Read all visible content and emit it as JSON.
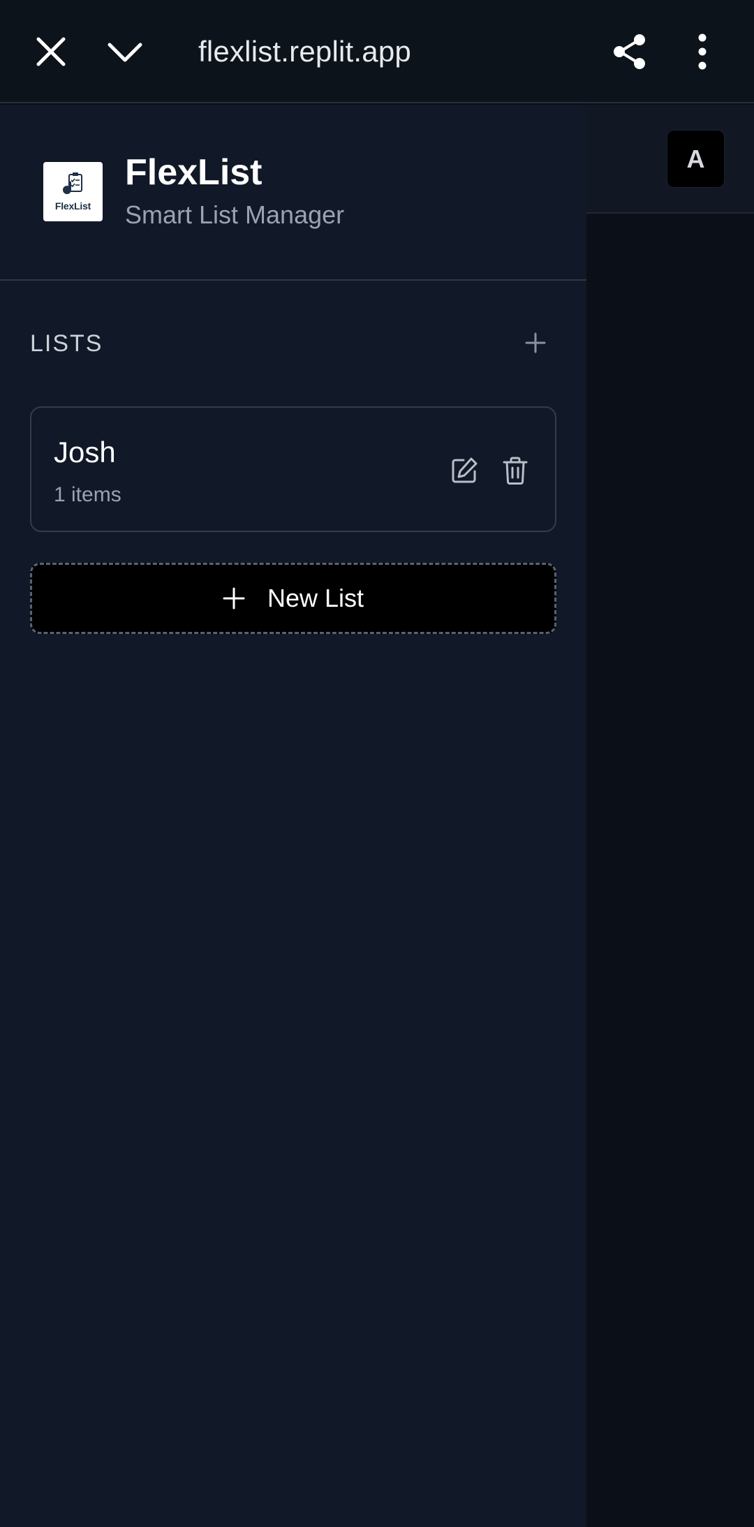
{
  "browser": {
    "url": "flexlist.replit.app",
    "icons": [
      "close-icon",
      "chevron-down-icon",
      "share-icon",
      "more-vertical-icon"
    ]
  },
  "header": {
    "avatar_initial": "A"
  },
  "sidebar": {
    "logo_text": "FlexList",
    "app_title": "FlexList",
    "app_subtitle": "Smart List Manager",
    "section_label": "LISTS",
    "lists": [
      {
        "name": "Josh",
        "count_label": "1 items"
      }
    ],
    "new_list_label": "New List"
  },
  "colors": {
    "drawer_bg": "#111827",
    "page_bg": "#0b0f17",
    "muted_text": "#9aa3b2",
    "border": "#343c49"
  }
}
